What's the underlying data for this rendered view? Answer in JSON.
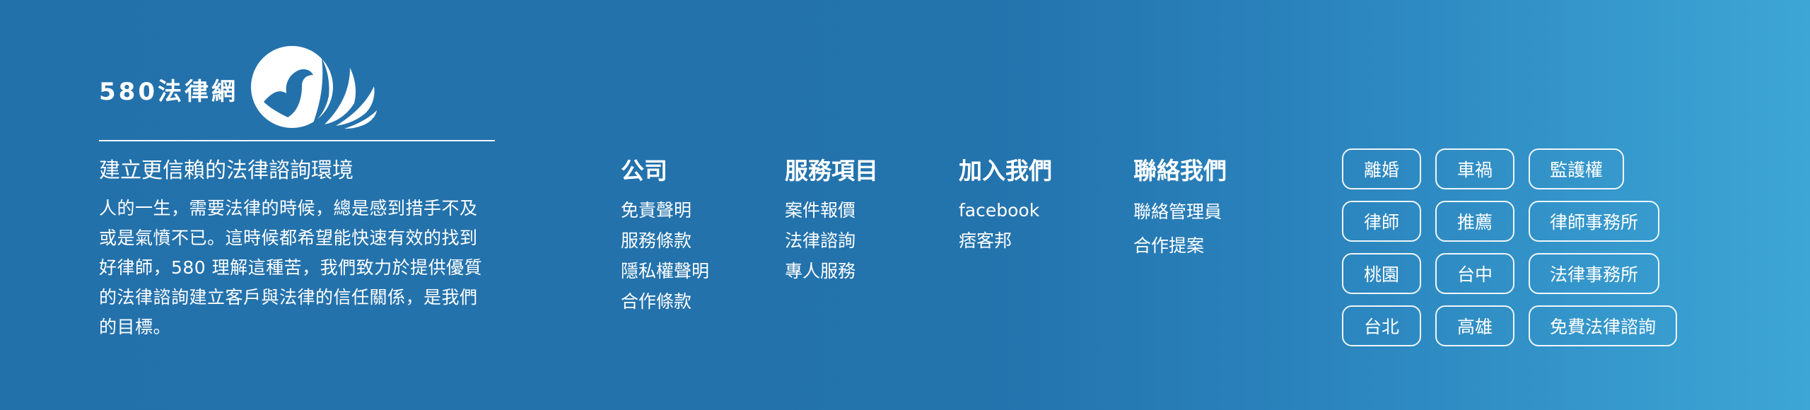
{
  "brand": {
    "name": "580法律網",
    "tagline": "建立更信賴的法律諮詢環境",
    "description": "人的一生，需要法律的時候，總是感到措手不及或是氣憤不已。這時候都希望能快速有效的找到好律師，580 理解這種苦，我們致力於提供優質的法律諮詢建立客戶與法律的信任關係，是我們的目標。",
    "logo_icon": "bird-wings-logo"
  },
  "columns": {
    "company": {
      "title": "公司",
      "items": [
        "免責聲明",
        "服務條款",
        "隱私權聲明",
        "合作條款"
      ]
    },
    "services": {
      "title": "服務項目",
      "items": [
        "案件報價",
        "法律諮詢",
        "專人服務"
      ]
    },
    "join": {
      "title": "加入我們",
      "items": [
        "facebook",
        "痞客邦"
      ]
    },
    "contact": {
      "title": "聯絡我們",
      "items": [
        "聯絡管理員",
        "合作提案"
      ]
    }
  },
  "tags": [
    [
      "離婚",
      "車禍",
      "監護權"
    ],
    [
      "律師",
      "推薦",
      "律師事務所"
    ],
    [
      "桃園",
      "台中",
      "法律事務所"
    ],
    [
      "台北",
      "高雄",
      "免費法律諮詢"
    ]
  ],
  "colors": {
    "background_start": "#2371ab",
    "background_end": "#3da6d6",
    "text": "#ffffff"
  }
}
